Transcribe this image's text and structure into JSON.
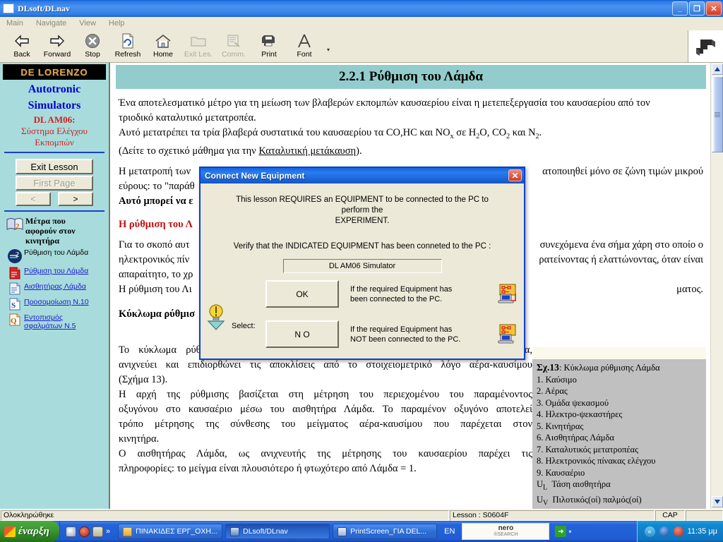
{
  "window": {
    "title": "DLsoft/DLnav",
    "controls": {
      "minimize": "_",
      "maximize": "❐",
      "close": "✕"
    }
  },
  "menu": {
    "items": [
      "Main",
      "Navigate",
      "View",
      "Help"
    ]
  },
  "toolbar": {
    "buttons": [
      {
        "label": "Back",
        "icon": "arrow-left-icon",
        "disabled": false
      },
      {
        "label": "Forward",
        "icon": "arrow-right-icon",
        "disabled": false
      },
      {
        "label": "Stop",
        "icon": "stop-icon",
        "disabled": false
      },
      {
        "label": "Refresh",
        "icon": "refresh-icon",
        "disabled": false
      },
      {
        "label": "Home",
        "icon": "home-icon",
        "disabled": false
      },
      {
        "label": "Exit Les.",
        "icon": "folder-icon",
        "disabled": true
      },
      {
        "label": "Comm.",
        "icon": "comm-icon",
        "disabled": true
      },
      {
        "label": "Print",
        "icon": "printer-icon",
        "disabled": false
      },
      {
        "label": "Font",
        "icon": "font-icon",
        "disabled": false
      }
    ],
    "dropdown_glyph": "▾"
  },
  "sidebar": {
    "brand": "DE LORENZO",
    "heading_line1": "Autotronic",
    "heading_line2": "Simulators",
    "course_code": "DL AM06:",
    "course_title_line1": "Σύστημα Ελέγχου",
    "course_title_line2": "Εκπομπών",
    "buttons": {
      "exit_lesson": "Exit  Lesson",
      "first_page": "First Page",
      "prev": "<",
      "next": ">"
    },
    "section": {
      "icon": "book-2-icon",
      "label_line1": "Μέτρα που",
      "label_line2": "αφορούν στον",
      "label_line3": "κινητήρα"
    },
    "items": [
      {
        "icon": "chapter-2-icon",
        "label": "Ρύθμιση του Λάμδα",
        "link": false
      },
      {
        "icon": "red-doc-icon",
        "label": "Ρύθμιση του Λάμδα",
        "link": true
      },
      {
        "icon": "blue-doc-icon",
        "label": "Αισθητήρας Λάμδα",
        "link": true
      },
      {
        "icon": "sim-s-icon",
        "label": "Προσομοίωση Ν.10",
        "link": true
      },
      {
        "icon": "quiz-q-icon",
        "label": "Εντοπισμός",
        "label2": "σφαλμάτων Ν.5",
        "link": true
      }
    ]
  },
  "page": {
    "heading": "2.2.1 Ρύθμιση του Λάμδα",
    "p1_line1": "Ένα αποτελεσματικό μέτρο για τη μείωση των βλαβερών εκπομπών καυσαερίου είναι η μετεπεξεργασία του καυσαερίου από τον",
    "p1_line2": "τριοδικό καταλυτικό μετατροπέα.",
    "p2_pre": "Αυτό μετατρέπει τα τρία βλαβερά συστατικά του καυσαερίου τα CO,HC και NO",
    "p2_sub1": "x",
    "p2_mid": " σε H",
    "p2_sub2": "2",
    "p2_mid2": "O, CO",
    "p2_sub3": "2",
    "p2_end": " και N",
    "p2_sub4": "2",
    "p2_dot": ".",
    "p3_pre": "(Δείτε το σχετικό μάθημα για την ",
    "p3_link": "Καταλυτική μετάκαυση",
    "p3_post": ").",
    "p4_line1_left": "Η μετατροπή των",
    "p4_line1_right": "ατοποιηθεί μόνο σε ζώνη τιμών μικρού",
    "p4_line2_left": "εύρους: το \"παράθ",
    "p4_line3_left": "Αυτό μπορεί να ε",
    "red_heading": "Η ρύθμιση του Λ",
    "p5_line1_left": "Για το σκοπό αυτ",
    "p5_line1_right": "συνεχόμενα ένα σήμα χάρη στο οποίο ο",
    "p5_line2_left": "ηλεκτρονικός πίν",
    "p5_line2_right": "ρατείνοντας ή ελαττώνοντας, όταν είναι",
    "p5_line3_left": "απαραίτητο, το χρ",
    "p5_line4_left": "Η ρύθμιση του Λι",
    "p5_line4_right": "ματος.",
    "black_heading": "Κύκλωμα ρύθμισ",
    "p6_line1": "Το κύκλωμα ρύθμισης, που έχει σχηματιστεί με τη βοήθεια του αισθητήρα Λάμδα,",
    "p6_line2": "ανιχνεύει και επιδιορθώνει τις αποκλίσεις από το στοιχειομετρικό λόγο αέρα-καυσίμου",
    "p6_line3": "(Σχήμα 13).",
    "p7_line1": "Η αρχή της ρύθμισης βασίζεται στη μέτρηση του περιεχομένου του παραμένοντος",
    "p7_line2": "οξυγόνου στο καυσαέριο μέσω του αισθητήρα Λάμδα. Το παραμένον οξυγόνο αποτελεί",
    "p7_line3": "τρόπο μέτρησης της σύνθεσης του μείγματος αέρα-καυσίμου που παρέχεται στον",
    "p7_line4": "κινητήρα.",
    "p8_line1": "Ο αισθητήρας Λάμδα, ως ανιχνευτής της μέτρησης του καυσαερίου παρέχει τις",
    "p8_line2": "πληροφορίες: το μείγμα είναι πλουσιότερο ή φτωχότερο από Λάμδα = 1."
  },
  "legend": {
    "title_bold": "Σχ.13",
    "title_rest": ": Κύκλωμα ρύθμισης Λάμδα",
    "entries": [
      "1. Καύσιμο",
      "2. Αέρας",
      "3. Ομάδα ψεκασμού",
      "4. Ηλεκτρο-ψεκαστήρες",
      "5. Κινητήρας",
      "6. Αισθητήρας Λάμδα",
      "7. Καταλυτικός μετατροπέας",
      "8. Ηλεκτρονικός πίνακας ελέγχου",
      "9. Καυσαέριο"
    ],
    "symbols": [
      {
        "sym": "U",
        "sub": "L",
        "text": "Τάση αισθητήρα"
      },
      {
        "sym": "U",
        "sub": "V",
        "text": "Πιλοτικός(οί) παλμός(οί)"
      }
    ]
  },
  "dialog": {
    "title": "Connect New Equipment",
    "close_glyph": "✕",
    "message_line1": "This lesson REQUIRES an EQUIPMENT to be connected to the PC to perform the",
    "message_line2": "EXPERIMENT.",
    "verify_text": "Verify that the INDICATED EQUIPMENT has been conneted to the PC :",
    "equipment_value": "DL AM06 Simulator",
    "select_label": "Select:",
    "ok_button": "OK",
    "no_button": "N O",
    "ok_desc_line1": "If the required Equipment has",
    "ok_desc_line2": "been connected to the PC.",
    "no_desc_line1": "If the required Equipment has",
    "no_desc_line2": "NOT been connected to the PC.",
    "bulb_icon": "lightbulb-icon",
    "pc_icon": "pc-connected-icon"
  },
  "statusbar": {
    "left": "Ολοκληρώθηκε",
    "lesson": "Lesson : S0604F",
    "caps": "CAP",
    "end": ""
  },
  "taskbar": {
    "start_label": "έναρξη",
    "quicklaunch_chevron": "»",
    "tasks": [
      {
        "label": "ΠΙΝΑΚΙΔΕΣ ΕΡΓ_ΟΧΗ...",
        "icon": "folder-icon",
        "active": false
      },
      {
        "label": "DLsoft/DLnav",
        "icon": "app-icon",
        "active": true
      },
      {
        "label": "PrintScreen_ΓΙΑ DEL...",
        "icon": "word-icon",
        "active": false
      }
    ],
    "language": "EN",
    "nero_line1": "nero",
    "nero_line2": "®SEARCH",
    "tray_arrow": "«",
    "clock": "11:35 μμ"
  },
  "scrollbar": {
    "up_glyph": "▲",
    "down_glyph": "▼"
  },
  "colors": {
    "title_blue": "#2a7ae8",
    "sidebar_teal": "#a8dcdc",
    "heading_band": "#93cccc",
    "brand_orange": "#d99a3a",
    "accent_red": "#d02020",
    "accent_blue": "#0000d0",
    "dialog_face": "#ece9d8",
    "legend_gray": "#c0c0c0"
  }
}
